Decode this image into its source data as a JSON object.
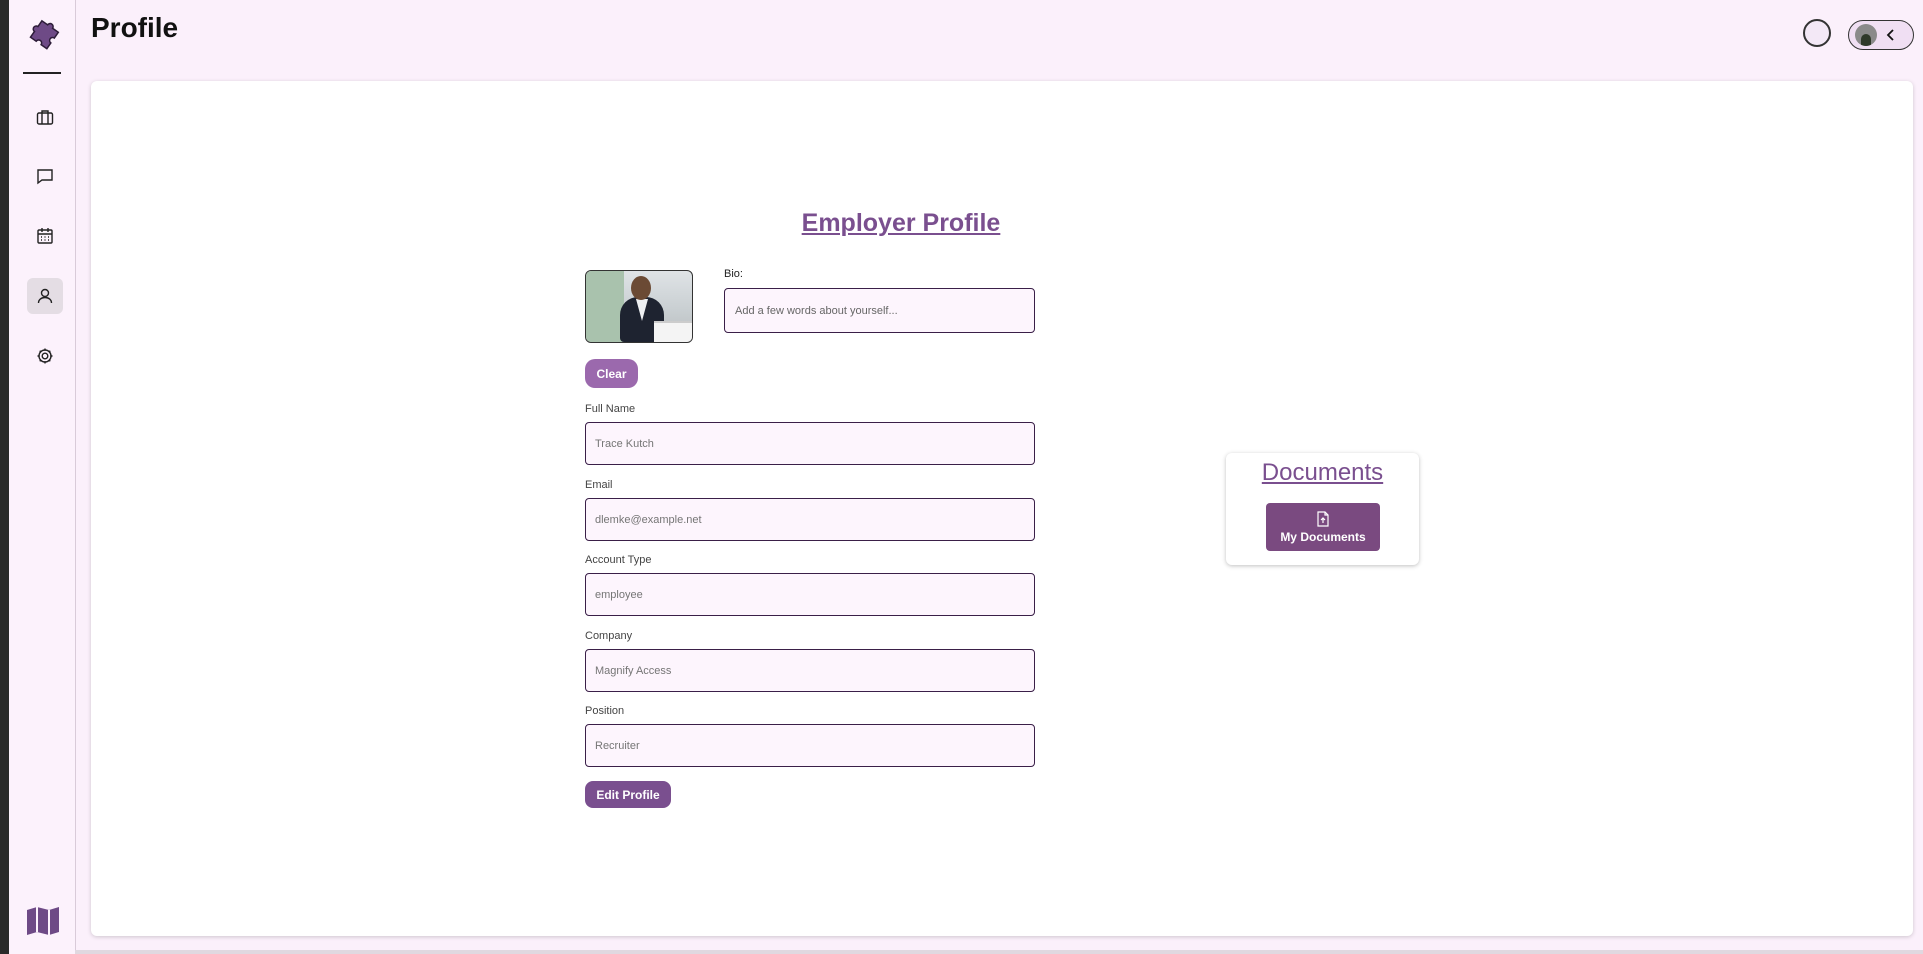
{
  "header": {
    "title": "Profile"
  },
  "sidebar": {
    "items": [
      {
        "name": "briefcase-icon"
      },
      {
        "name": "chat-icon"
      },
      {
        "name": "calendar-icon"
      },
      {
        "name": "user-icon",
        "active": true
      },
      {
        "name": "gear-icon"
      }
    ]
  },
  "profile": {
    "heading": "Employer Profile",
    "bio_label": "Bio:",
    "bio_placeholder": "Add a few words about yourself...",
    "clear_label": "Clear",
    "fields": [
      {
        "label": "Full Name",
        "placeholder": "Trace Kutch"
      },
      {
        "label": "Email",
        "placeholder": "dlemke@example.net"
      },
      {
        "label": "Account Type",
        "placeholder": "employee"
      },
      {
        "label": "Company",
        "placeholder": "Magnify Access"
      },
      {
        "label": "Position",
        "placeholder": "Recruiter"
      }
    ],
    "edit_label": "Edit Profile"
  },
  "documents": {
    "title": "Documents",
    "button_label": "My Documents"
  },
  "colors": {
    "accent": "#7a4f8f",
    "clear_button": "#9b69ad",
    "background": "#fbf0fb",
    "input_border": "#3a1f48"
  }
}
